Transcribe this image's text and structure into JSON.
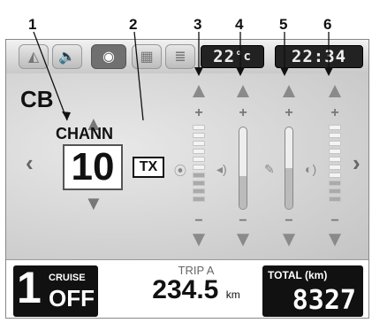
{
  "callouts": [
    "1",
    "2",
    "3",
    "4",
    "5",
    "6"
  ],
  "tabs": [
    {
      "icon": "triangle-icon",
      "glyph": "◭"
    },
    {
      "icon": "speaker-icon",
      "glyph": "🔈"
    },
    {
      "icon": "cb-radio-icon",
      "glyph": "◉"
    },
    {
      "icon": "map-icon",
      "glyph": "▦"
    },
    {
      "icon": "list-icon",
      "glyph": "≣"
    }
  ],
  "temperature": {
    "value": "22",
    "unit": "°c"
  },
  "clock": "22:34",
  "cb": {
    "label": "CB",
    "channel_label": "CHANN",
    "channel_value": "10",
    "tx_label": "TX",
    "left_arrow": "‹",
    "right_arrow": "›"
  },
  "level_controls": [
    {
      "icon": "cb-antenna-icon",
      "glyph": "⦿",
      "style": "ladder",
      "level_fraction": 0.35
    },
    {
      "icon": "speaker-level-icon",
      "glyph": "◂)",
      "style": "tube",
      "level_fraction": 0.4
    },
    {
      "icon": "microphone-icon",
      "glyph": "✎",
      "style": "tube",
      "level_fraction": 0.5
    },
    {
      "icon": "headset-icon",
      "glyph": "◐)",
      "style": "ladder",
      "level_fraction": 0.3
    }
  ],
  "controls": {
    "up": "▲",
    "down": "▼",
    "plus": "+",
    "minus": "−"
  },
  "bottom": {
    "gear": "1",
    "cruise_label": "CRUISE",
    "cruise_state": "OFF",
    "trip_label": "TRIP A",
    "trip_value": "234.5",
    "trip_unit": "km",
    "total_label": "TOTAL (km)",
    "total_value": "8327"
  }
}
